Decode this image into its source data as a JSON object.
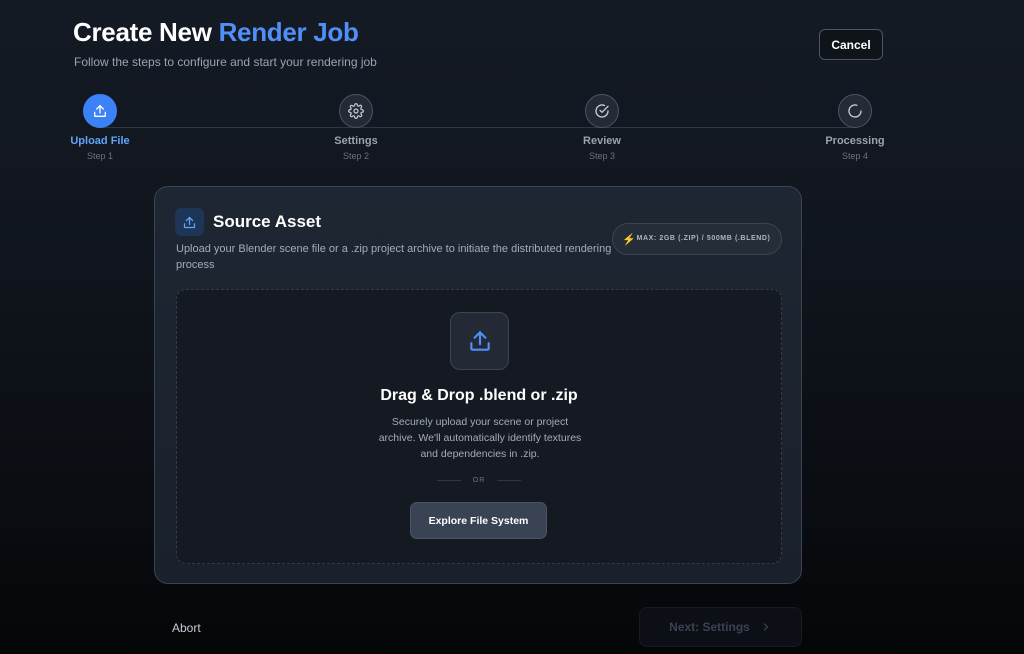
{
  "header": {
    "title_prefix": "Create New",
    "title_accent": "Render Job",
    "subtitle": "Follow the steps to configure and start your rendering job",
    "cancel_label": "Cancel"
  },
  "steps": [
    {
      "label": "Upload File",
      "step": "Step 1",
      "icon": "upload-icon",
      "active": true
    },
    {
      "label": "Settings",
      "step": "Step 2",
      "icon": "gear-icon",
      "active": false
    },
    {
      "label": "Review",
      "step": "Step 3",
      "icon": "check-circle-icon",
      "active": false
    },
    {
      "label": "Processing",
      "step": "Step 4",
      "icon": "spinner-icon",
      "active": false
    }
  ],
  "card": {
    "title": "Source Asset",
    "description": "Upload your Blender scene file or a .zip project archive to initiate the distributed rendering process",
    "limit_badge": "MAX: 2GB (.ZIP) / 500MB (.BLEND)",
    "dropzone": {
      "title": "Drag & Drop .blend or .zip",
      "text": "Securely upload your scene or project archive. We'll automatically identify textures and dependencies in .zip.",
      "divider": "OR",
      "button_label": "Explore File System"
    }
  },
  "footer": {
    "abort_label": "Abort",
    "next_label": "Next: Settings"
  },
  "colors": {
    "accent": "#3b82f6",
    "accent_text": "#4f8ff7",
    "warning": "#f5b301",
    "background": "#10151d"
  }
}
